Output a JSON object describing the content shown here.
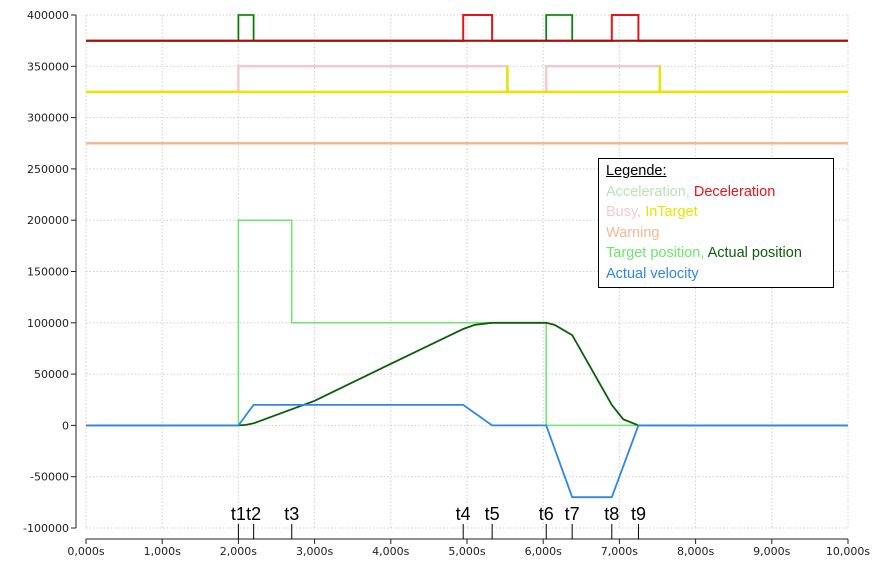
{
  "chart_data": {
    "type": "line",
    "title": "",
    "xlabel": "",
    "ylabel": "",
    "xlim": [
      0,
      10
    ],
    "ylim": [
      -100000,
      400000
    ],
    "grid": true,
    "x_ticks": [
      0,
      1,
      2,
      3,
      4,
      5,
      6,
      7,
      8,
      9,
      10
    ],
    "x_tick_labels": [
      "0,000s",
      "1,000s",
      "2,000s",
      "3,000s",
      "4,000s",
      "5,000s",
      "6,000s",
      "7,000s",
      "8,000s",
      "9,000s",
      "10,000s"
    ],
    "y_ticks": [
      -100000,
      -50000,
      0,
      50000,
      100000,
      150000,
      200000,
      250000,
      300000,
      350000,
      400000
    ],
    "y_tick_labels": [
      "-100000",
      "-50000",
      "0",
      "50000",
      "100000",
      "150000",
      "200000",
      "250000",
      "300000",
      "350000",
      "400000"
    ],
    "legend": {
      "title": "Legende:",
      "placement": "right",
      "rows": [
        [
          {
            "text": "Acceleration,",
            "color": "#b7e4b9"
          },
          {
            "text": "Deceleration",
            "color": "#e8141c"
          }
        ],
        [
          {
            "text": "Busy,",
            "color": "#f9c8cc"
          },
          {
            "text": "InTarget",
            "color": "#e6e600"
          }
        ],
        [
          {
            "text": "Warning",
            "color": "#f5b896"
          }
        ],
        [
          {
            "text": "Target position,",
            "color": "#6ee66e"
          },
          {
            "text": "Actual position",
            "color": "#0a5d0a"
          }
        ],
        [
          {
            "text": "Actual velocity",
            "color": "#2f86e8"
          }
        ]
      ]
    },
    "markers": [
      {
        "label": "t1",
        "x": 2.0
      },
      {
        "label": "t2",
        "x": 2.2
      },
      {
        "label": "t3",
        "x": 2.7
      },
      {
        "label": "t4",
        "x": 4.95
      },
      {
        "label": "t5",
        "x": 5.33
      },
      {
        "label": "t6",
        "x": 6.04
      },
      {
        "label": "t7",
        "x": 6.38
      },
      {
        "label": "t8",
        "x": 6.9
      },
      {
        "label": "t9",
        "x": 7.25
      }
    ],
    "series": [
      {
        "name": "Warning",
        "color": "#f5b896",
        "width": 2.5,
        "x": [
          0,
          10
        ],
        "y": [
          275000,
          275000
        ]
      },
      {
        "name": "Busy",
        "color": "#f9c8cc",
        "width": 2.5,
        "x": [
          0,
          2.0,
          2.0,
          5.53,
          5.53,
          6.04,
          6.04,
          7.53,
          7.53,
          10
        ],
        "y": [
          325000,
          325000,
          350000,
          350000,
          325000,
          325000,
          350000,
          350000,
          325000,
          325000
        ]
      },
      {
        "name": "InTarget",
        "color": "#e6e600",
        "width": 2.5,
        "x": [
          0,
          5.53,
          5.53,
          5.53,
          7.53,
          7.53,
          7.53,
          10
        ],
        "y": [
          325000,
          325000,
          350000,
          325000,
          325000,
          350000,
          325000,
          325000
        ]
      },
      {
        "name": "Acceleration",
        "color": "#b7e4b9",
        "width": 2.5,
        "x": [
          0,
          2.0,
          2.0,
          2.2,
          2.2,
          6.04,
          6.04,
          6.38,
          6.38,
          10
        ],
        "y": [
          375000,
          375000,
          400000,
          400000,
          375000,
          375000,
          400000,
          400000,
          375000,
          375000
        ]
      },
      {
        "name": "Deceleration",
        "color": "#e8141c",
        "width": 2,
        "x": [
          0,
          4.95,
          4.95,
          5.33,
          5.33,
          6.9,
          6.9,
          7.25,
          7.25,
          10
        ],
        "y": [
          375000,
          375000,
          400000,
          400000,
          375000,
          375000,
          400000,
          400000,
          375000,
          375000
        ]
      },
      {
        "name": "Acceleration edge",
        "color": "#0a7a0a",
        "width": 1.5,
        "x": [
          0,
          2.0,
          2.0,
          2.2,
          2.2,
          6.04,
          6.04,
          6.38,
          6.38,
          10
        ],
        "y": [
          375000,
          375000,
          400000,
          400000,
          375000,
          375000,
          400000,
          400000,
          375000,
          375000
        ]
      },
      {
        "name": "State baseline",
        "color": "#a81010",
        "width": 2,
        "x": [
          0,
          2.0,
          2.2,
          4.95,
          5.33,
          6.04,
          6.38,
          6.9,
          7.25,
          10
        ],
        "y": [
          375000,
          375000,
          375000,
          375000,
          375000,
          375000,
          375000,
          375000,
          375000,
          375000
        ]
      },
      {
        "name": "Target position",
        "color": "#6ee66e",
        "width": 1.5,
        "x": [
          0,
          2.0,
          2.0,
          2.7,
          2.7,
          6.04,
          6.04,
          10
        ],
        "y": [
          0,
          0,
          200000,
          200000,
          100000,
          100000,
          0,
          0
        ]
      },
      {
        "name": "Actual position",
        "color": "#0a5d0a",
        "width": 1.8,
        "x": [
          0,
          2.0,
          2.1,
          2.2,
          3.0,
          4.0,
          4.95,
          5.1,
          5.33,
          6.04,
          6.15,
          6.38,
          6.9,
          7.05,
          7.25,
          10
        ],
        "y": [
          0,
          0,
          500,
          2000,
          24000,
          60000,
          94000,
          98000,
          100000,
          100000,
          98000,
          88000,
          20000,
          6000,
          0,
          0
        ]
      },
      {
        "name": "Actual velocity",
        "color": "#2f86e8",
        "width": 1.8,
        "x": [
          0,
          2.0,
          2.2,
          4.95,
          5.33,
          6.04,
          6.38,
          6.9,
          7.25,
          10
        ],
        "y": [
          0,
          0,
          20000,
          20000,
          0,
          0,
          -70000,
          -70000,
          0,
          0
        ]
      }
    ]
  }
}
